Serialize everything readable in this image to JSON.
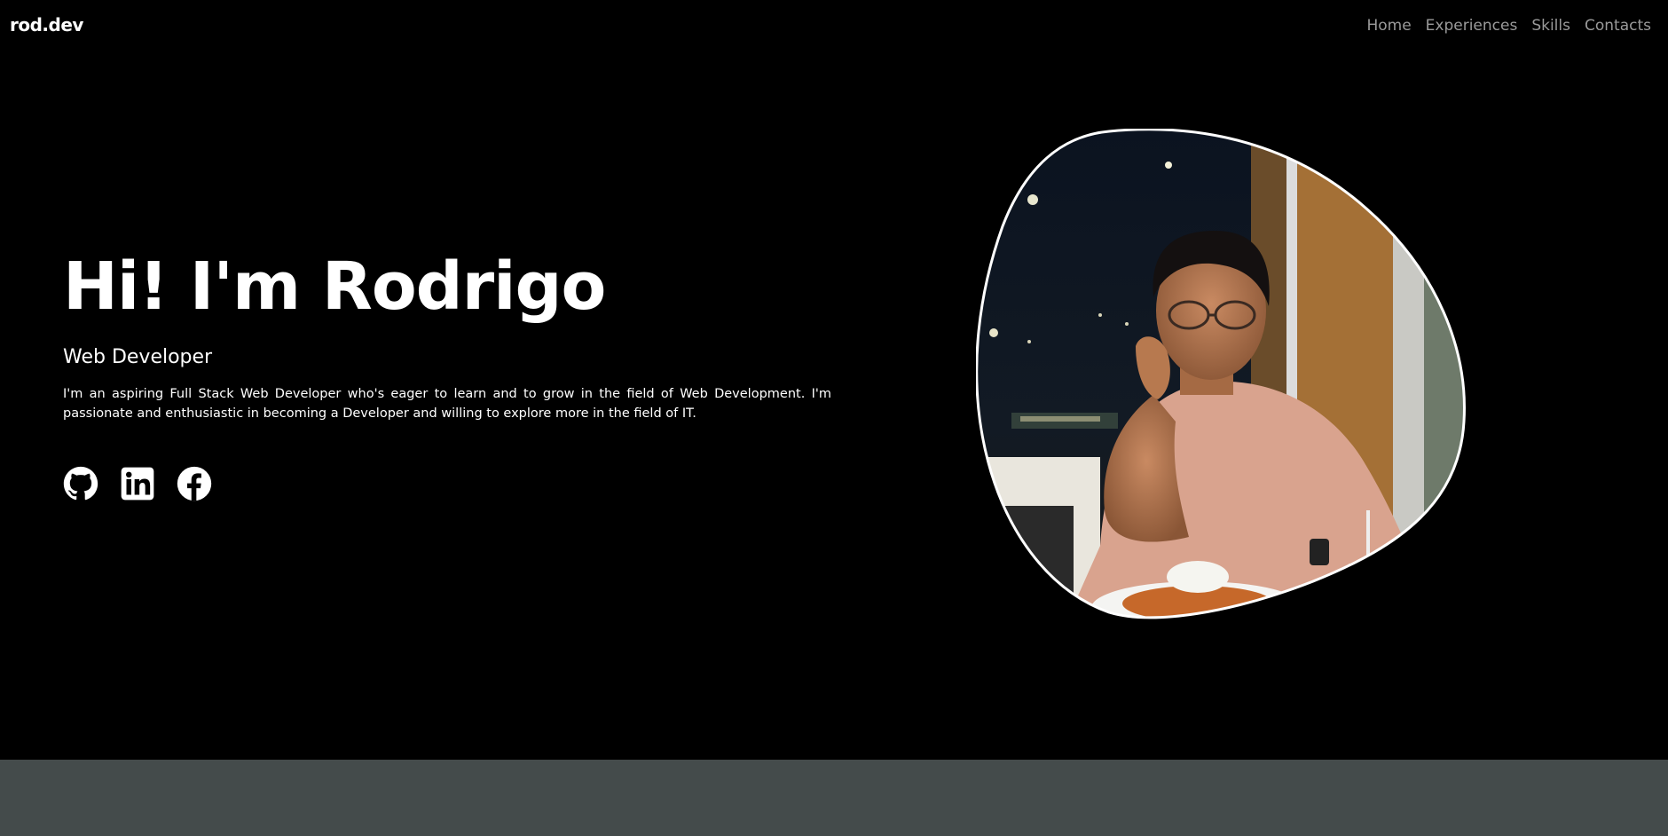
{
  "brand": "rod.dev",
  "nav": {
    "home": "Home",
    "experiences": "Experiences",
    "skills": "Skills",
    "contacts": "Contacts"
  },
  "hero": {
    "title": "Hi! I'm Rodrigo",
    "role": "Web Developer",
    "description": "I'm an aspiring Full Stack Web Developer who's eager to learn and to grow in the field of Web Development. I'm passionate and enthusiastic in becoming a Developer and willing to explore more in the field of IT."
  },
  "socials": [
    {
      "icon": "github-icon"
    },
    {
      "icon": "linkedin-icon"
    },
    {
      "icon": "facebook-icon"
    }
  ],
  "colors": {
    "background": "#000000",
    "text": "#ffffff",
    "nav_text": "#9a9a9a",
    "bottom_band": "#444b4b"
  }
}
